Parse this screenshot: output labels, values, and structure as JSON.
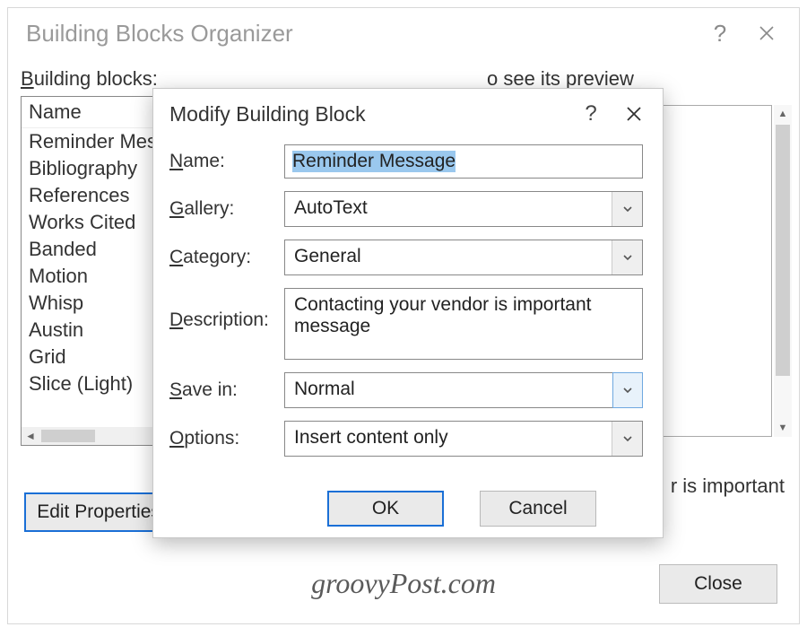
{
  "organizer": {
    "title": "Building Blocks Organizer",
    "building_blocks_label": "Building blocks:",
    "preview_label": "o see its preview",
    "column_header": "Name",
    "items": [
      "Reminder Mes",
      "Bibliography",
      "References",
      "Works Cited",
      "Banded",
      "Motion",
      "Whisp",
      "Austin",
      "Grid",
      "Slice (Light)"
    ],
    "preview_caption": "r is important",
    "edit_properties_label": "Edit Properties.",
    "close_label": "Close"
  },
  "modal": {
    "title": "Modify Building Block",
    "labels": {
      "name": "Name:",
      "gallery": "Gallery:",
      "category": "Category:",
      "description": "Description:",
      "save_in": "Save in:",
      "options": "Options:"
    },
    "values": {
      "name": "Reminder Message",
      "gallery": "AutoText",
      "category": "General",
      "description": "Contacting your vendor is important message",
      "save_in": "Normal",
      "options": "Insert content only"
    },
    "ok_label": "OK",
    "cancel_label": "Cancel"
  },
  "watermark": "groovyPost.com"
}
